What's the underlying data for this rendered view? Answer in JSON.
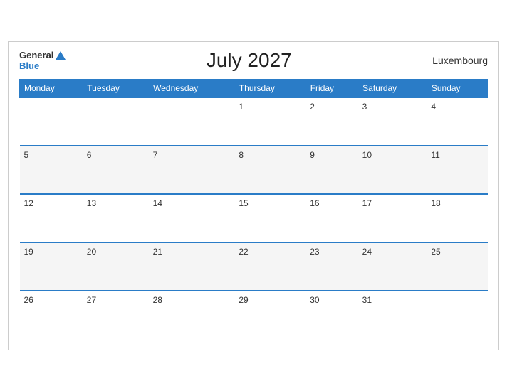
{
  "header": {
    "logo_general": "General",
    "logo_blue": "Blue",
    "title": "July 2027",
    "country": "Luxembourg"
  },
  "days": [
    "Monday",
    "Tuesday",
    "Wednesday",
    "Thursday",
    "Friday",
    "Saturday",
    "Sunday"
  ],
  "weeks": [
    [
      "",
      "",
      "",
      "1",
      "2",
      "3",
      "4"
    ],
    [
      "5",
      "6",
      "7",
      "8",
      "9",
      "10",
      "11"
    ],
    [
      "12",
      "13",
      "14",
      "15",
      "16",
      "17",
      "18"
    ],
    [
      "19",
      "20",
      "21",
      "22",
      "23",
      "24",
      "25"
    ],
    [
      "26",
      "27",
      "28",
      "29",
      "30",
      "31",
      ""
    ]
  ]
}
